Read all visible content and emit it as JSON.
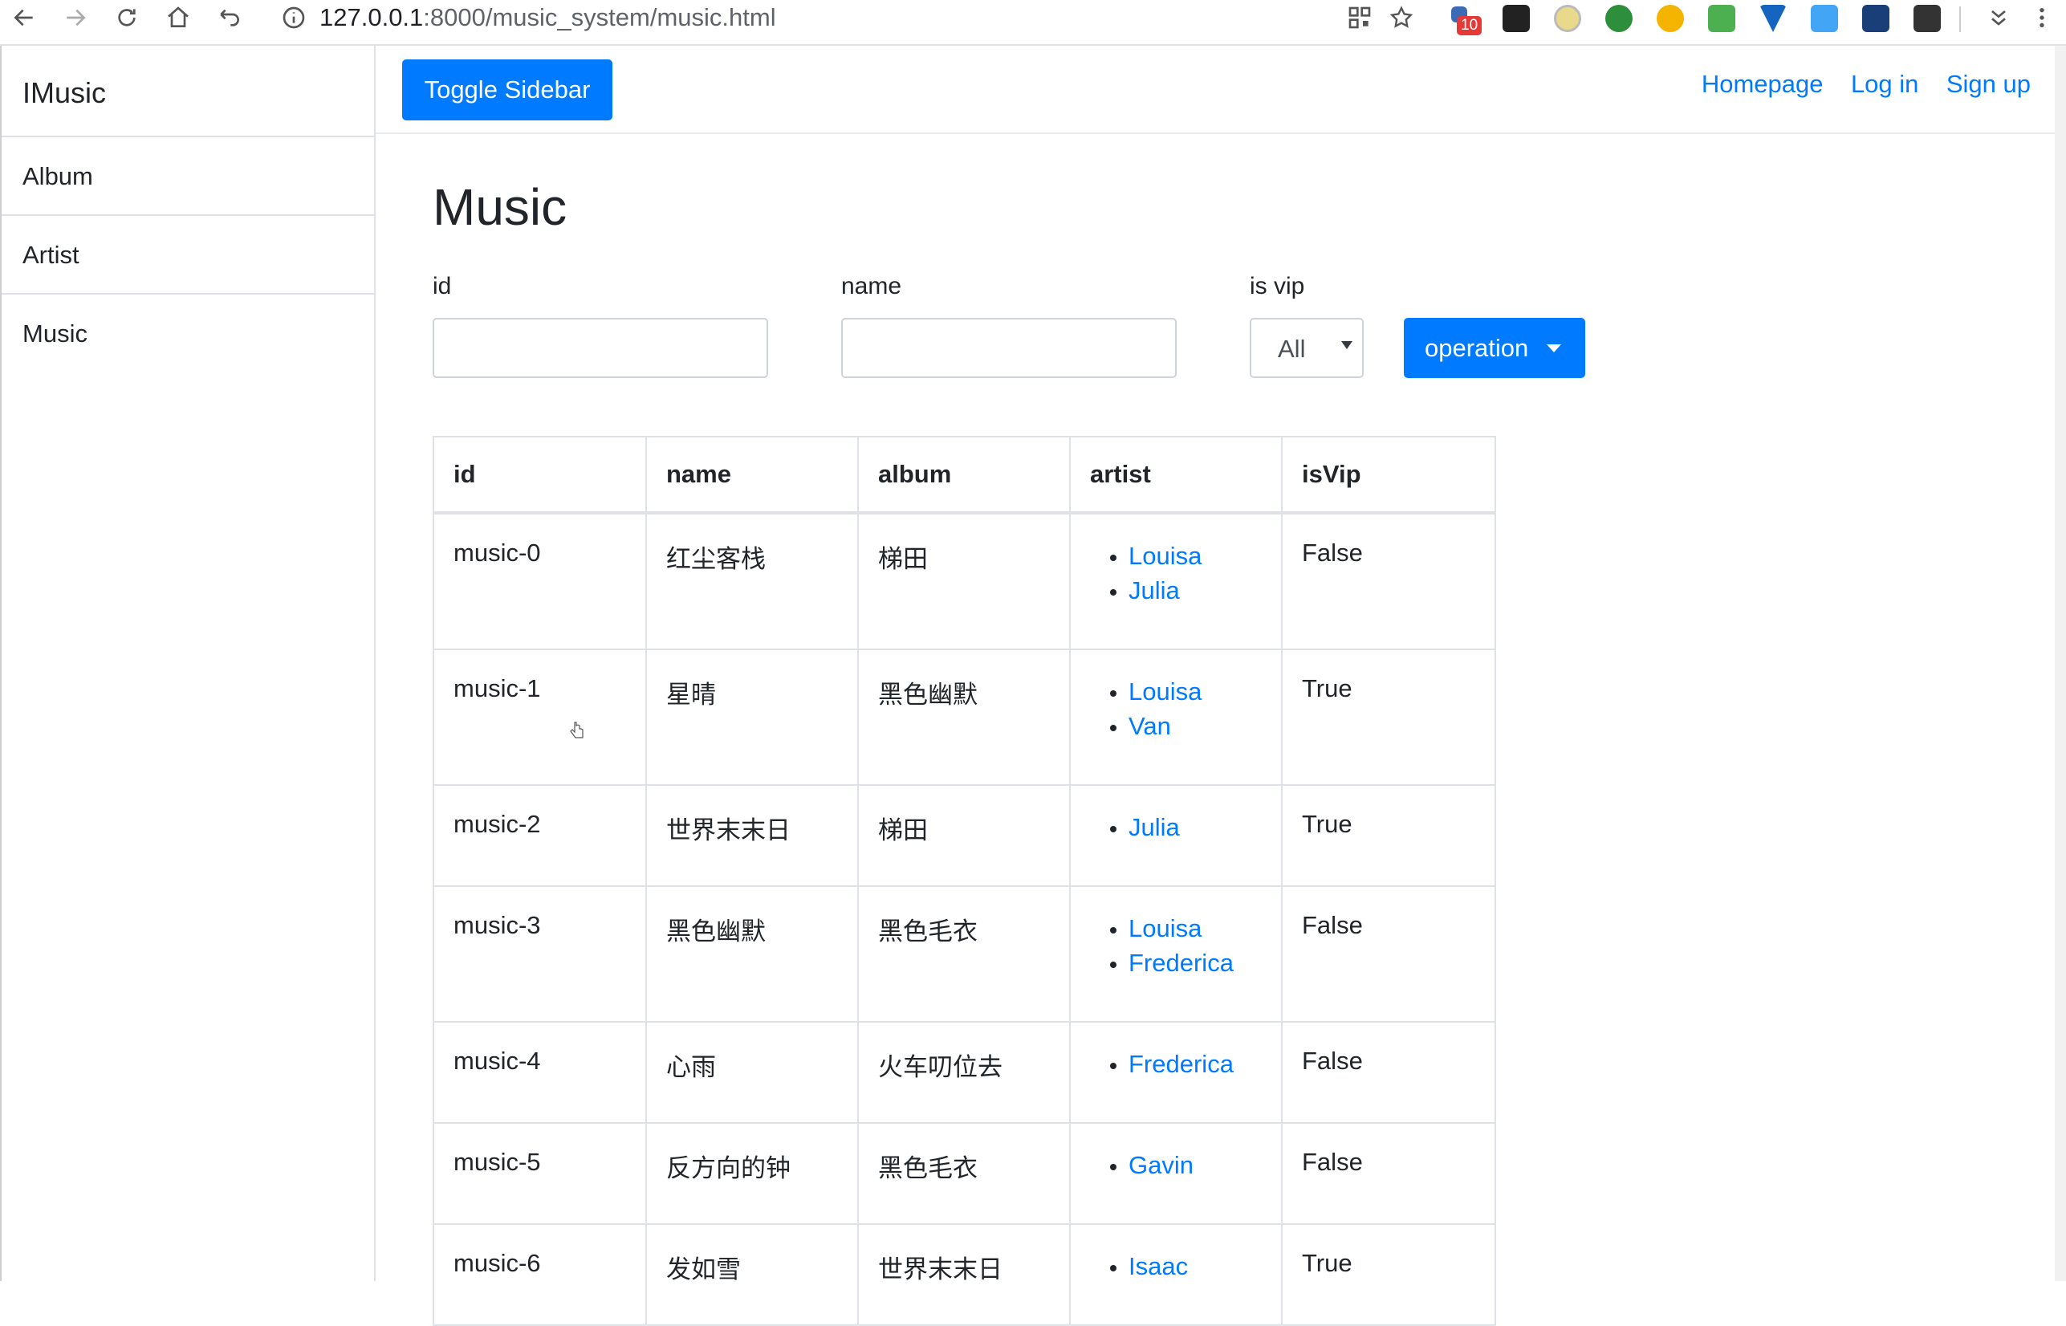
{
  "browser": {
    "url_host": "127.0.0.1",
    "url_rest": ":8000/music_system/music.html",
    "extension_badge": "10"
  },
  "sidebar": {
    "brand": "IMusic",
    "items": [
      {
        "label": "Album"
      },
      {
        "label": "Artist"
      },
      {
        "label": "Music"
      }
    ]
  },
  "topbar": {
    "toggle_label": "Toggle Sidebar",
    "links": [
      {
        "label": "Homepage"
      },
      {
        "label": "Log in"
      },
      {
        "label": "Sign up"
      }
    ]
  },
  "page": {
    "title": "Music",
    "filters": {
      "id_label": "id",
      "name_label": "name",
      "isvip_label": "is vip",
      "isvip_value": "All",
      "operation_label": "operation"
    }
  },
  "table": {
    "headers": [
      "id",
      "name",
      "album",
      "artist",
      "isVip"
    ],
    "rows": [
      {
        "id": "music-0",
        "name": "红尘客栈",
        "album": "梯田",
        "artists": [
          "Louisa",
          "Julia"
        ],
        "isVip": "False"
      },
      {
        "id": "music-1",
        "name": "星晴",
        "album": "黑色幽默",
        "artists": [
          "Louisa",
          "Van"
        ],
        "isVip": "True"
      },
      {
        "id": "music-2",
        "name": "世界末末日",
        "album": "梯田",
        "artists": [
          "Julia"
        ],
        "isVip": "True"
      },
      {
        "id": "music-3",
        "name": "黑色幽默",
        "album": "黑色毛衣",
        "artists": [
          "Louisa",
          "Frederica"
        ],
        "isVip": "False"
      },
      {
        "id": "music-4",
        "name": "心雨",
        "album": "火车叨位去",
        "artists": [
          "Frederica"
        ],
        "isVip": "False"
      },
      {
        "id": "music-5",
        "name": "反方向的钟",
        "album": "黑色毛衣",
        "artists": [
          "Gavin"
        ],
        "isVip": "False"
      },
      {
        "id": "music-6",
        "name": "发如雪",
        "album": "世界末末日",
        "artists": [
          "Isaac"
        ],
        "isVip": "True"
      }
    ]
  },
  "colors": {
    "primary": "#007bff",
    "border": "#dee2e6",
    "text": "#212529"
  }
}
